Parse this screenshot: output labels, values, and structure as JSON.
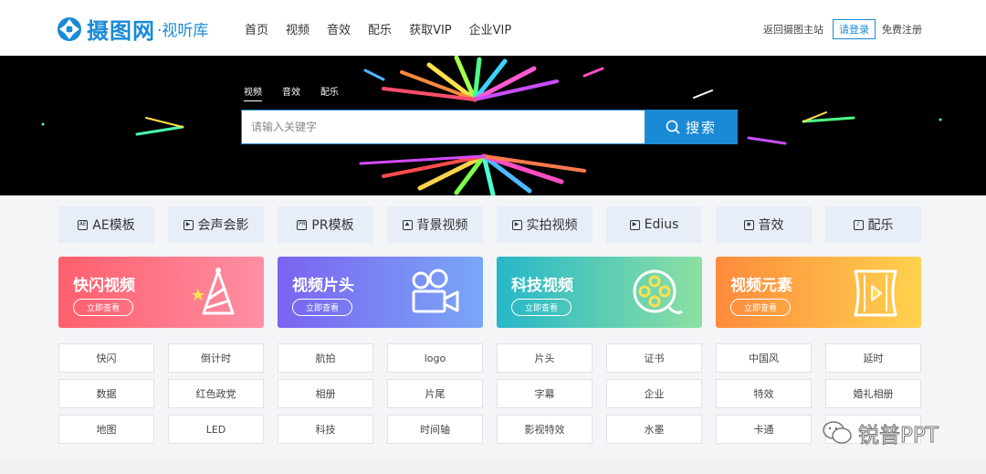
{
  "header": {
    "logo_name": "摄图网",
    "logo_sub": "·视听库",
    "nav": [
      "首页",
      "视频",
      "音效",
      "配乐",
      "获取VIP",
      "企业VIP"
    ],
    "back_link": "返回摄图主站",
    "login": "请登录",
    "register": "免费注册"
  },
  "banner": {
    "tabs": [
      "视频",
      "音效",
      "配乐"
    ],
    "search_placeholder": "请输入关键字",
    "search_button": "搜索"
  },
  "categories": [
    {
      "label": "AE模板",
      "icon": "ae-icon"
    },
    {
      "label": "会声会影",
      "icon": "play-icon"
    },
    {
      "label": "PR模板",
      "icon": "pr-icon"
    },
    {
      "label": "背景视频",
      "icon": "image-icon"
    },
    {
      "label": "实拍视频",
      "icon": "video-camera-icon"
    },
    {
      "label": "Edius",
      "icon": "play-icon"
    },
    {
      "label": "音效",
      "icon": "speaker-icon"
    },
    {
      "label": "配乐",
      "icon": "music-note-icon"
    }
  ],
  "promos": [
    {
      "title": "快闪视频",
      "button": "立即查看",
      "colors": [
        "#ff5f6d",
        "#ff8fa3"
      ],
      "icon": "party-hat-icon"
    },
    {
      "title": "视频片头",
      "button": "立即查看",
      "colors": [
        "#7a63f0",
        "#7aa7f7"
      ],
      "icon": "film-camera-icon"
    },
    {
      "title": "科技视频",
      "button": "立即查看",
      "colors": [
        "#26b7c9",
        "#8de0a2"
      ],
      "icon": "film-reel-icon"
    },
    {
      "title": "视频元素",
      "button": "立即查看",
      "colors": [
        "#ff8a3d",
        "#ffd24d"
      ],
      "icon": "film-strip-icon"
    }
  ],
  "tags": [
    [
      "快闪",
      "倒计时",
      "航拍",
      "logo",
      "片头",
      "证书",
      "中国风",
      "延时"
    ],
    [
      "数据",
      "红色政党",
      "相册",
      "片尾",
      "字幕",
      "企业",
      "特效",
      "婚礼相册"
    ],
    [
      "地图",
      "LED",
      "科技",
      "时间轴",
      "影视特效",
      "水墨",
      "卡通",
      ""
    ]
  ],
  "watermark": "锐普PPT",
  "colors": {
    "brand": "#1a8ad6"
  }
}
